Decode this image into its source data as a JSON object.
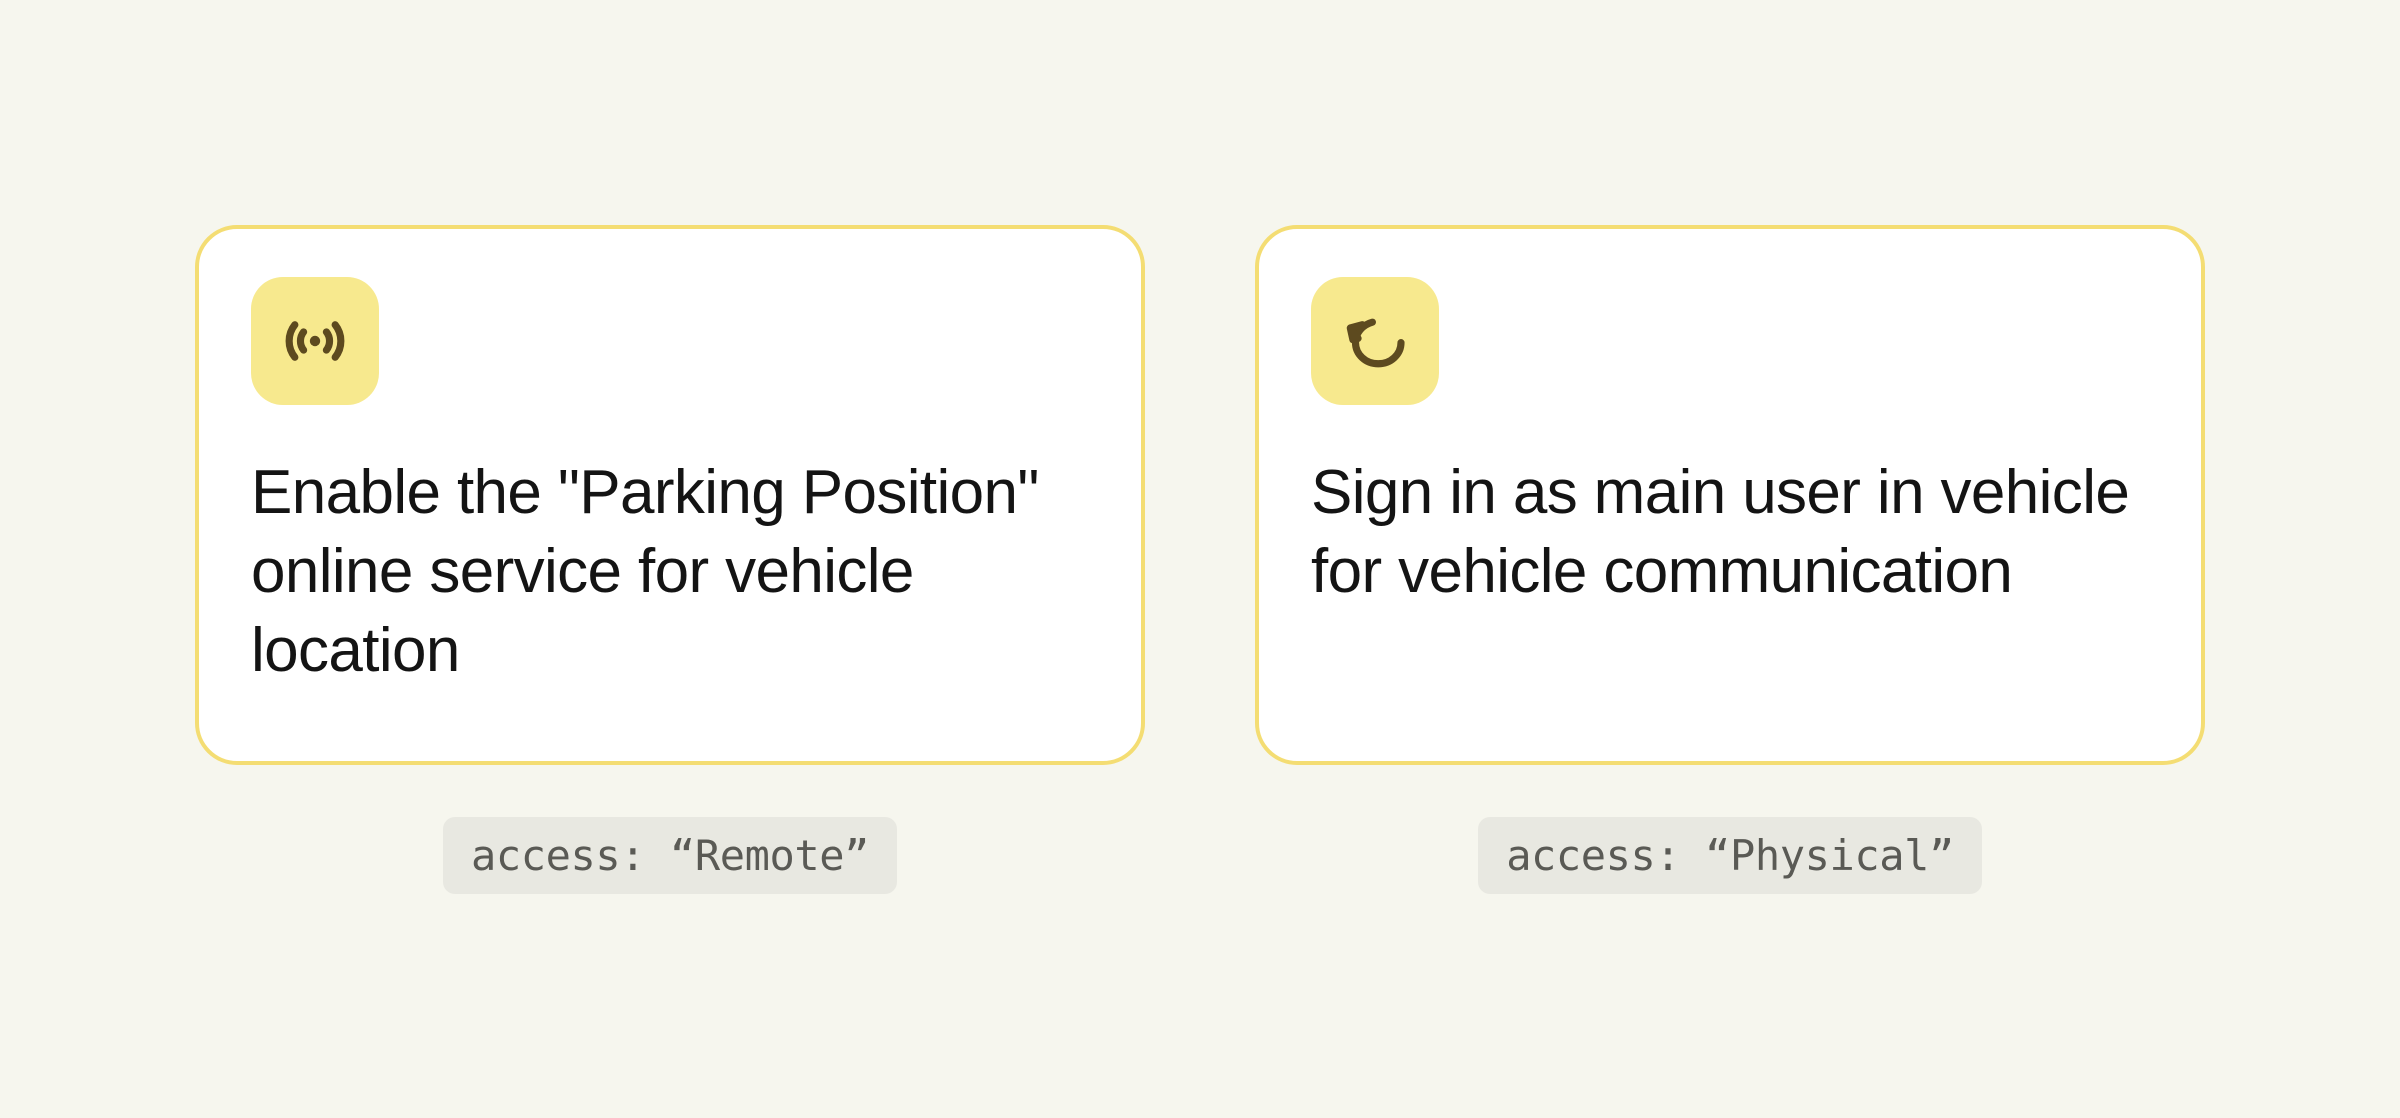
{
  "cards": [
    {
      "icon": "radio-icon",
      "text": "Enable the \"Parking Position\" online service for vehicle location",
      "badge_key": "access",
      "badge_value": "Remote"
    },
    {
      "icon": "hand-pointer-icon",
      "text": "Sign in as main user in vehicle for vehicle communication",
      "badge_key": "access",
      "badge_value": "Physical"
    }
  ]
}
